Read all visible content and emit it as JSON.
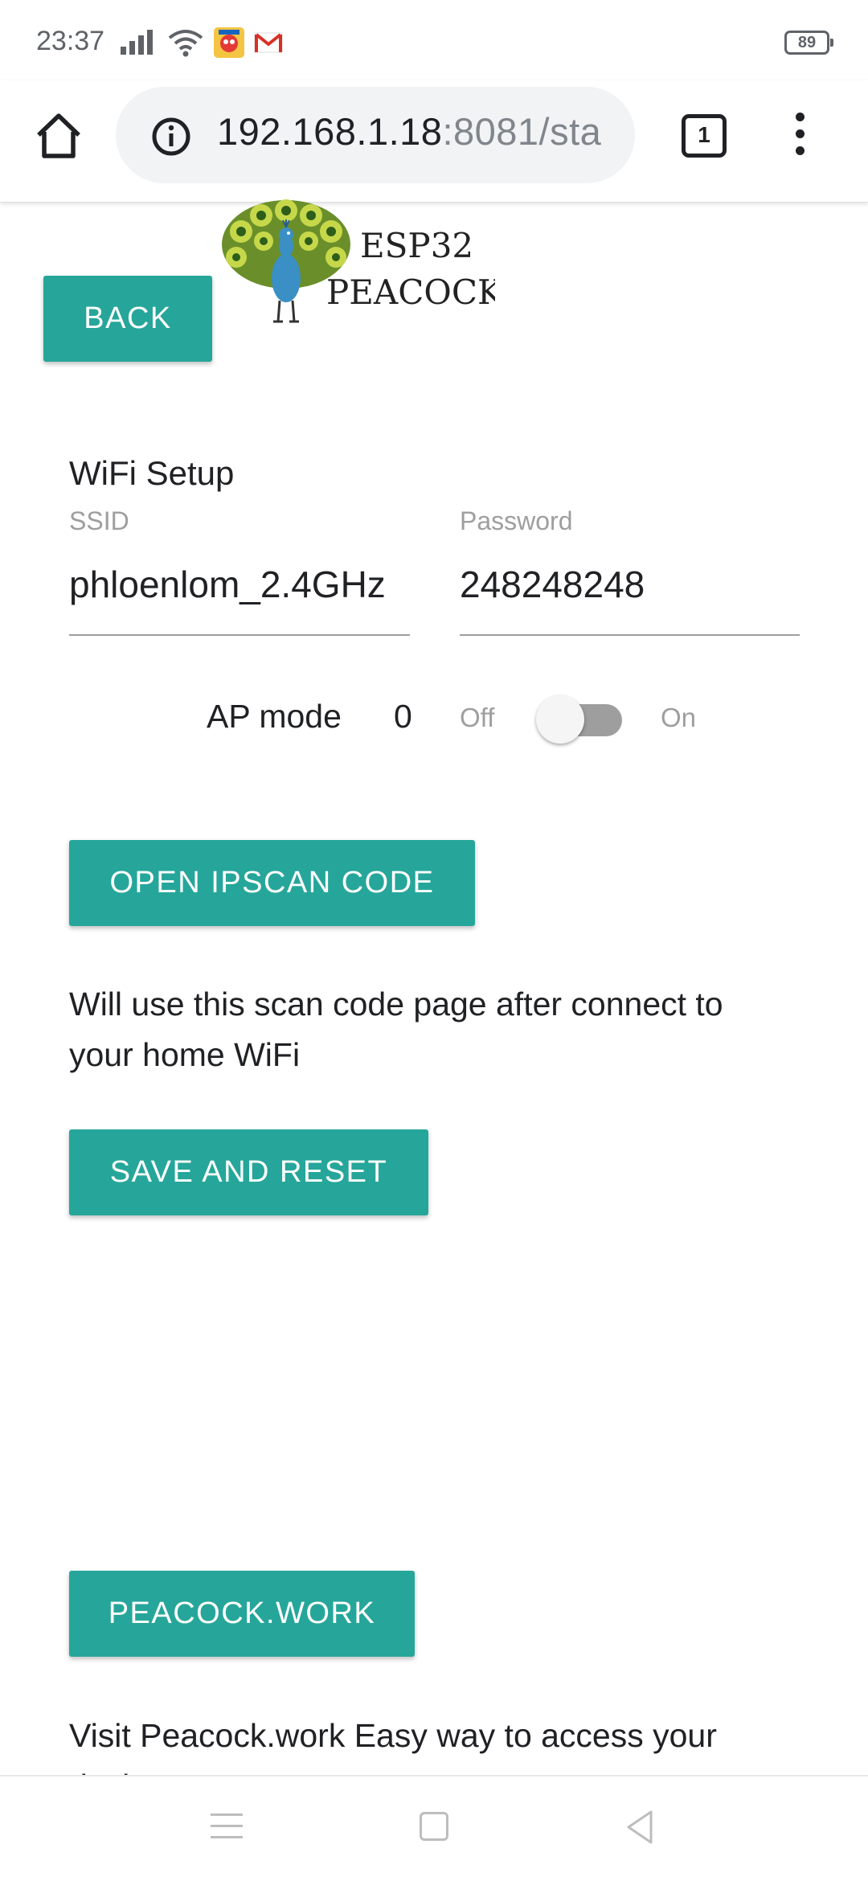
{
  "status_bar": {
    "time": "23:37",
    "battery": "89",
    "icons": [
      "signal-icon",
      "wifi-icon",
      "app-notification-icon",
      "gmail-icon"
    ]
  },
  "browser": {
    "url_host": "192.168.1.18",
    "url_rest": ":8081/sta",
    "tab_count": "1",
    "icons": [
      "home-icon",
      "info-icon",
      "more-vert-icon"
    ]
  },
  "page": {
    "logo": {
      "line1": "ESP32",
      "line2": "PEACOCK"
    },
    "back_label": "BACK",
    "wifi_title": "WiFi Setup",
    "ssid_label": "SSID",
    "ssid_value": "phloenlom_2.4GHz",
    "password_label": "Password",
    "password_value": "248248248",
    "ap_mode_label": "AP mode",
    "ap_mode_value": "0",
    "switch_off_label": "Off",
    "switch_on_label": "On",
    "ipscan_label": "OPEN IPSCAN CODE",
    "ipscan_note": "Will use this scan code page after connect to your home WiFi",
    "save_label": "SAVE AND RESET",
    "peacock_label": "PEACOCK.WORK",
    "peacock_note": "Visit Peacock.work Easy way to access your devices"
  },
  "colors": {
    "accent": "#26a69a",
    "text": "#202124",
    "muted": "#9e9e9e"
  },
  "navbar": {
    "icons": [
      "recent-apps-icon",
      "home-square-icon",
      "back-triangle-icon"
    ]
  }
}
